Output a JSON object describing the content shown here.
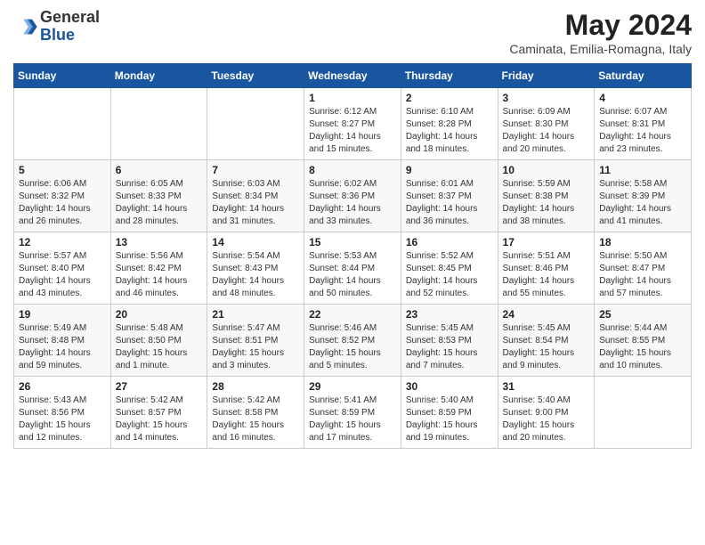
{
  "header": {
    "logo_general": "General",
    "logo_blue": "Blue",
    "month_title": "May 2024",
    "location": "Caminata, Emilia-Romagna, Italy"
  },
  "weekdays": [
    "Sunday",
    "Monday",
    "Tuesday",
    "Wednesday",
    "Thursday",
    "Friday",
    "Saturday"
  ],
  "weeks": [
    [
      {
        "day": "",
        "info": ""
      },
      {
        "day": "",
        "info": ""
      },
      {
        "day": "",
        "info": ""
      },
      {
        "day": "1",
        "info": "Sunrise: 6:12 AM\nSunset: 8:27 PM\nDaylight: 14 hours\nand 15 minutes."
      },
      {
        "day": "2",
        "info": "Sunrise: 6:10 AM\nSunset: 8:28 PM\nDaylight: 14 hours\nand 18 minutes."
      },
      {
        "day": "3",
        "info": "Sunrise: 6:09 AM\nSunset: 8:30 PM\nDaylight: 14 hours\nand 20 minutes."
      },
      {
        "day": "4",
        "info": "Sunrise: 6:07 AM\nSunset: 8:31 PM\nDaylight: 14 hours\nand 23 minutes."
      }
    ],
    [
      {
        "day": "5",
        "info": "Sunrise: 6:06 AM\nSunset: 8:32 PM\nDaylight: 14 hours\nand 26 minutes."
      },
      {
        "day": "6",
        "info": "Sunrise: 6:05 AM\nSunset: 8:33 PM\nDaylight: 14 hours\nand 28 minutes."
      },
      {
        "day": "7",
        "info": "Sunrise: 6:03 AM\nSunset: 8:34 PM\nDaylight: 14 hours\nand 31 minutes."
      },
      {
        "day": "8",
        "info": "Sunrise: 6:02 AM\nSunset: 8:36 PM\nDaylight: 14 hours\nand 33 minutes."
      },
      {
        "day": "9",
        "info": "Sunrise: 6:01 AM\nSunset: 8:37 PM\nDaylight: 14 hours\nand 36 minutes."
      },
      {
        "day": "10",
        "info": "Sunrise: 5:59 AM\nSunset: 8:38 PM\nDaylight: 14 hours\nand 38 minutes."
      },
      {
        "day": "11",
        "info": "Sunrise: 5:58 AM\nSunset: 8:39 PM\nDaylight: 14 hours\nand 41 minutes."
      }
    ],
    [
      {
        "day": "12",
        "info": "Sunrise: 5:57 AM\nSunset: 8:40 PM\nDaylight: 14 hours\nand 43 minutes."
      },
      {
        "day": "13",
        "info": "Sunrise: 5:56 AM\nSunset: 8:42 PM\nDaylight: 14 hours\nand 46 minutes."
      },
      {
        "day": "14",
        "info": "Sunrise: 5:54 AM\nSunset: 8:43 PM\nDaylight: 14 hours\nand 48 minutes."
      },
      {
        "day": "15",
        "info": "Sunrise: 5:53 AM\nSunset: 8:44 PM\nDaylight: 14 hours\nand 50 minutes."
      },
      {
        "day": "16",
        "info": "Sunrise: 5:52 AM\nSunset: 8:45 PM\nDaylight: 14 hours\nand 52 minutes."
      },
      {
        "day": "17",
        "info": "Sunrise: 5:51 AM\nSunset: 8:46 PM\nDaylight: 14 hours\nand 55 minutes."
      },
      {
        "day": "18",
        "info": "Sunrise: 5:50 AM\nSunset: 8:47 PM\nDaylight: 14 hours\nand 57 minutes."
      }
    ],
    [
      {
        "day": "19",
        "info": "Sunrise: 5:49 AM\nSunset: 8:48 PM\nDaylight: 14 hours\nand 59 minutes."
      },
      {
        "day": "20",
        "info": "Sunrise: 5:48 AM\nSunset: 8:50 PM\nDaylight: 15 hours\nand 1 minute."
      },
      {
        "day": "21",
        "info": "Sunrise: 5:47 AM\nSunset: 8:51 PM\nDaylight: 15 hours\nand 3 minutes."
      },
      {
        "day": "22",
        "info": "Sunrise: 5:46 AM\nSunset: 8:52 PM\nDaylight: 15 hours\nand 5 minutes."
      },
      {
        "day": "23",
        "info": "Sunrise: 5:45 AM\nSunset: 8:53 PM\nDaylight: 15 hours\nand 7 minutes."
      },
      {
        "day": "24",
        "info": "Sunrise: 5:45 AM\nSunset: 8:54 PM\nDaylight: 15 hours\nand 9 minutes."
      },
      {
        "day": "25",
        "info": "Sunrise: 5:44 AM\nSunset: 8:55 PM\nDaylight: 15 hours\nand 10 minutes."
      }
    ],
    [
      {
        "day": "26",
        "info": "Sunrise: 5:43 AM\nSunset: 8:56 PM\nDaylight: 15 hours\nand 12 minutes."
      },
      {
        "day": "27",
        "info": "Sunrise: 5:42 AM\nSunset: 8:57 PM\nDaylight: 15 hours\nand 14 minutes."
      },
      {
        "day": "28",
        "info": "Sunrise: 5:42 AM\nSunset: 8:58 PM\nDaylight: 15 hours\nand 16 minutes."
      },
      {
        "day": "29",
        "info": "Sunrise: 5:41 AM\nSunset: 8:59 PM\nDaylight: 15 hours\nand 17 minutes."
      },
      {
        "day": "30",
        "info": "Sunrise: 5:40 AM\nSunset: 8:59 PM\nDaylight: 15 hours\nand 19 minutes."
      },
      {
        "day": "31",
        "info": "Sunrise: 5:40 AM\nSunset: 9:00 PM\nDaylight: 15 hours\nand 20 minutes."
      },
      {
        "day": "",
        "info": ""
      }
    ]
  ]
}
